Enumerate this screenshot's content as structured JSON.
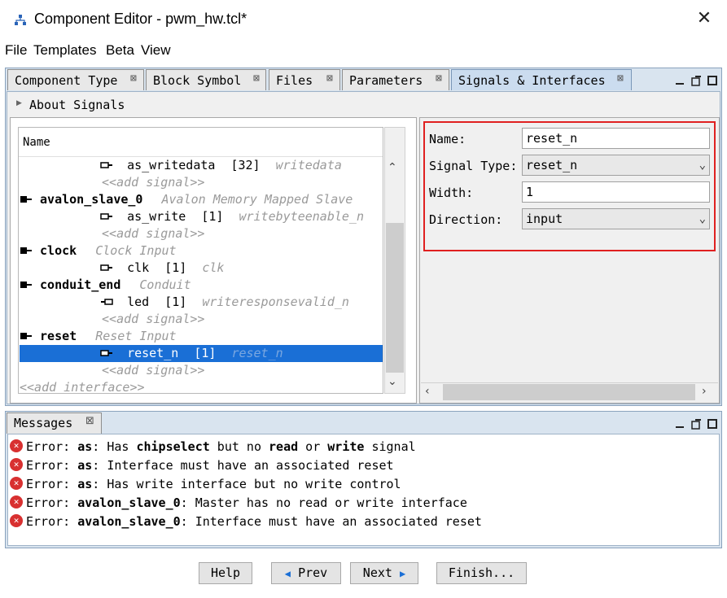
{
  "window": {
    "title": "Component Editor - pwm_hw.tcl*",
    "close_glyph": "✕"
  },
  "menu": [
    {
      "label": "File"
    },
    {
      "label": "Templates"
    },
    {
      "label": "Beta"
    },
    {
      "label": "View"
    }
  ],
  "tabs": [
    {
      "label": "Component Type",
      "active": false
    },
    {
      "label": "Block Symbol",
      "active": false
    },
    {
      "label": "Files",
      "active": false
    },
    {
      "label": "Parameters",
      "active": false
    },
    {
      "label": "Signals & Interfaces",
      "active": true
    }
  ],
  "tab_close_glyph": "⊠",
  "about": {
    "label": "About Signals"
  },
  "tree": {
    "header": "Name",
    "rows": [
      {
        "name": "as_writedata",
        "width": "[32]",
        "type": "writedata",
        "kind": "signal"
      },
      {
        "name": "<<add signal>>",
        "kind": "add"
      },
      {
        "name": "avalon_slave_0",
        "type": "Avalon Memory Mapped Slave",
        "kind": "interface"
      },
      {
        "name": "as_write",
        "width": "[1]",
        "type": "writebyteenable_n",
        "kind": "signal"
      },
      {
        "name": "<<add signal>>",
        "kind": "add"
      },
      {
        "name": "clock",
        "type": "Clock Input",
        "kind": "interface"
      },
      {
        "name": "clk",
        "width": "[1]",
        "type": "clk",
        "kind": "signal"
      },
      {
        "name": "conduit_end",
        "type": "Conduit",
        "kind": "interface"
      },
      {
        "name": "led",
        "width": "[1]",
        "type": "writeresponsevalid_n",
        "kind": "signal-out"
      },
      {
        "name": "<<add signal>>",
        "kind": "add"
      },
      {
        "name": "reset",
        "type": "Reset Input",
        "kind": "interface"
      },
      {
        "name": "reset_n",
        "width": "[1]",
        "type": "reset_n",
        "kind": "signal",
        "selected": true
      },
      {
        "name": "<<add signal>>",
        "kind": "add"
      },
      {
        "name": "<<add interface>>",
        "kind": "add-interface"
      }
    ]
  },
  "props": {
    "name_label": "Name:",
    "name_value": "reset_n",
    "type_label": "Signal Type:",
    "type_value": "reset_n",
    "width_label": "Width:",
    "width_value": "1",
    "direction_label": "Direction:",
    "direction_value": "input"
  },
  "messages": {
    "tab_label": "Messages",
    "items": [
      {
        "prefix": "Error: ",
        "parts": [
          [
            "b",
            "as"
          ],
          [
            "t",
            ": Has "
          ],
          [
            "b",
            "chipselect"
          ],
          [
            "t",
            " but no "
          ],
          [
            "b",
            "read"
          ],
          [
            "t",
            " or "
          ],
          [
            "b",
            "write"
          ],
          [
            "t",
            " signal"
          ]
        ]
      },
      {
        "prefix": "Error: ",
        "parts": [
          [
            "b",
            "as"
          ],
          [
            "t",
            ": Interface must have an associated reset"
          ]
        ]
      },
      {
        "prefix": "Error: ",
        "parts": [
          [
            "b",
            "as"
          ],
          [
            "t",
            ": Has write interface but no write control"
          ]
        ]
      },
      {
        "prefix": "Error: ",
        "parts": [
          [
            "b",
            "avalon_slave_0"
          ],
          [
            "t",
            ": Master has no read or write interface"
          ]
        ]
      },
      {
        "prefix": "Error: ",
        "parts": [
          [
            "b",
            "avalon_slave_0"
          ],
          [
            "t",
            ": Interface must have an associated reset"
          ]
        ]
      }
    ]
  },
  "buttons": {
    "help": "Help",
    "prev": "Prev",
    "next": "Next",
    "finish": "Finish..."
  },
  "colors": {
    "selection": "#1a6fd6",
    "error": "#d83030",
    "highlight_border": "#e02020",
    "active_tab": "#cbdcef"
  }
}
